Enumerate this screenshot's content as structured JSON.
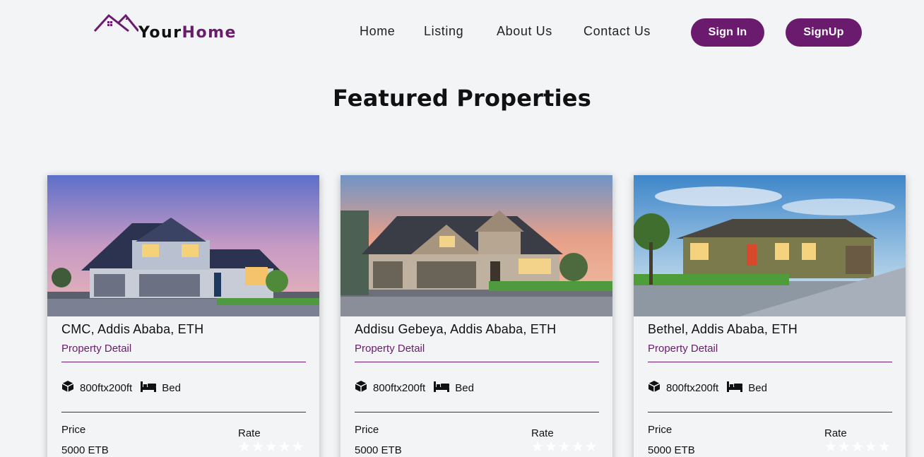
{
  "header": {
    "logo": {
      "text_part1": "Your",
      "text_part2": "Home",
      "brand_color": "#6a1b6e"
    },
    "nav": [
      {
        "label": "Home"
      },
      {
        "label": "Listing"
      },
      {
        "label": "About Us"
      },
      {
        "label": "Contact Us"
      }
    ],
    "buttons": {
      "signin_label": "Sign In",
      "signup_label": "SignUp"
    }
  },
  "section": {
    "title": "Featured Properties"
  },
  "cards": [
    {
      "location": "CMC, Addis Ababa, ETH",
      "detail_link": "Property Detail",
      "area": "800ftx200ft",
      "bed": "Bed",
      "price_label": "Price",
      "price": "5000 ETB",
      "rate_label": "Rate",
      "rating": 0,
      "image_desc": "house-image"
    },
    {
      "location": "Addisu Gebeya, Addis Ababa, ETH",
      "detail_link": "Property Detail",
      "area": "800ftx200ft",
      "bed": "Bed",
      "price_label": "Price",
      "price": "5000 ETB",
      "rate_label": "Rate",
      "rating": 0,
      "image_desc": "house-image"
    },
    {
      "location": "Bethel, Addis Ababa, ETH",
      "detail_link": "Property Detail",
      "area": "800ftx200ft",
      "bed": "Bed",
      "price_label": "Price",
      "price": "5000 ETB",
      "rate_label": "Rate",
      "rating": 0,
      "image_desc": "house-image"
    }
  ],
  "icons": {
    "area": "cube-icon",
    "bed": "bed-icon",
    "rating": "star-icon"
  },
  "colors": {
    "accent": "#6a1b6e",
    "background": "#f3f4f6"
  }
}
